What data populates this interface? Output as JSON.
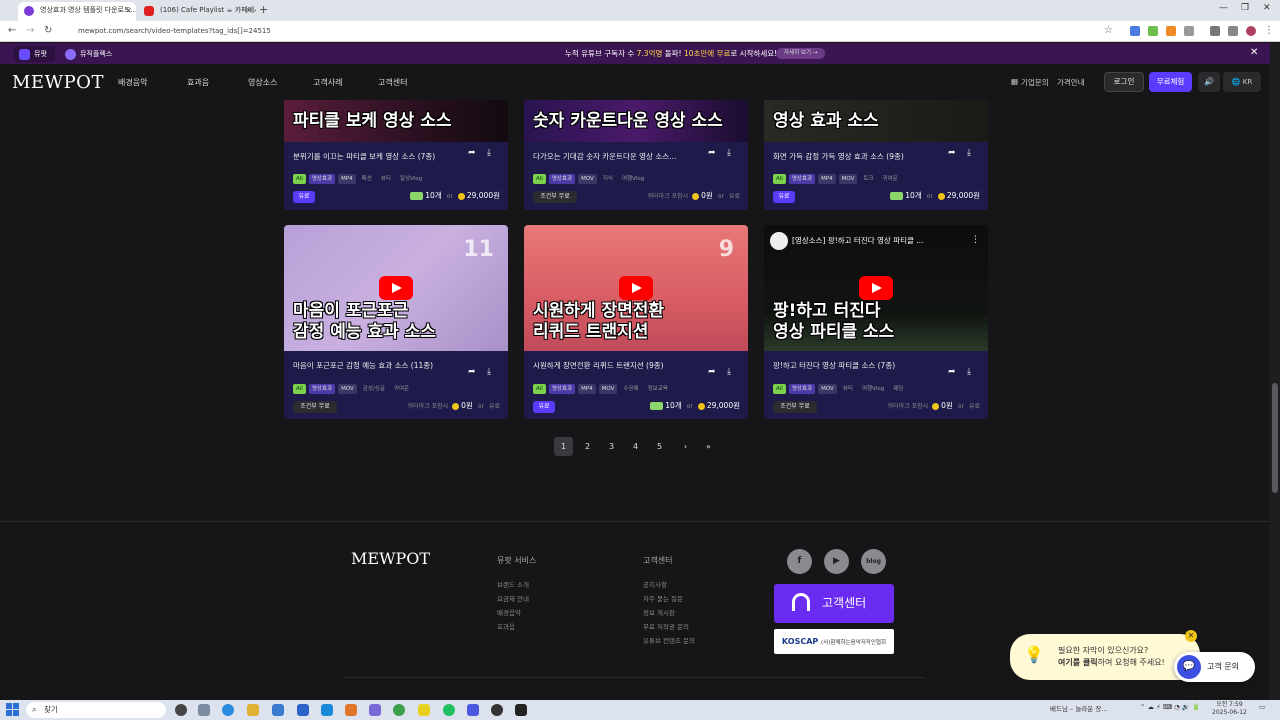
{
  "browser": {
    "tabs": [
      {
        "title": "영상효과 영상 템플릿 다운로드...",
        "active": true
      },
      {
        "title": "(106) Cafe Playlist ☕ 카페에서...",
        "active": false
      }
    ],
    "url": "mewpot.com/search/video-templates?tag_ids[]=24515"
  },
  "promo": {
    "bookmark1": "뮤팟",
    "bookmark2": "뮤직플렉스",
    "text_a": "누적 유튜브 구독자 수 ",
    "text_b": "7.3억명",
    "text_c": " 돌파! ",
    "text_d": "10초만에 무료",
    "text_e": "로 시작하세요!",
    "pill": "자세히 보기 →",
    "close": "✕"
  },
  "nav": {
    "brand": "MEWPOT",
    "menu": [
      "배경음악",
      "효과음",
      "영상소스",
      "고객사례",
      "고객센터"
    ],
    "enterprise": "기업문의",
    "pricing": "가격안내",
    "login": "로그인",
    "trial": "무료체험",
    "sound": "🔊",
    "lang": "🌐 KR"
  },
  "top_cards": [
    {
      "thumb_title": "파티클 보케 영상 소스",
      "title": "분위기를 이끄는 파티클 보케 영상 소스 (7종)",
      "tags": [
        "All",
        "영상효과",
        "MP4",
        "패션",
        "뷰티",
        "일상Vlog"
      ],
      "price_type": "paid",
      "badge": "유료",
      "tickets": "10개",
      "or": "or",
      "price": "29,000원"
    },
    {
      "thumb_title": "숫자 카운트다운 영상 소스",
      "title": "다가오는 기대감 숫자 카운트다운 영상 소스...",
      "tags": [
        "All",
        "영상효과",
        "MOV",
        "지식",
        "여행Vlog"
      ],
      "price_type": "free",
      "badge": "조건부 무료",
      "note": "워터마크 포함시",
      "price": "0원",
      "or": "or",
      "alt": "유료"
    },
    {
      "thumb_title": "영상 효과 소스",
      "title": "화면 가득 감정 가득 영상 효과 소스 (9종)",
      "tags": [
        "All",
        "영상효과",
        "MP4",
        "MOV",
        "토크",
        "귀여운"
      ],
      "price_type": "paid",
      "badge": "유료",
      "tickets": "10개",
      "or": "or",
      "price": "29,000원"
    }
  ],
  "bottom_cards": [
    {
      "thumb_line1": "마음이 포근포근",
      "thumb_line2": "감정 예능 효과 소스",
      "count": "11",
      "title": "마음이 포근포근 감정 예능 효과 소스 (11종)",
      "tags": [
        "All",
        "영상효과",
        "MOV",
        "감성/싱글",
        "귀여운"
      ],
      "price_type": "free",
      "badge": "조건부 무료",
      "note": "워터마크 포함시",
      "price": "0원",
      "or": "or",
      "alt": "유료"
    },
    {
      "thumb_line1": "시원하게 장면전환",
      "thumb_line2": "리퀴드 트랜지션",
      "count": "9",
      "title": "시원하게 장면전환 리퀴드 트랜지션 (9종)",
      "tags": [
        "All",
        "영상효과",
        "MP4",
        "MOV",
        "수공예",
        "정보교육"
      ],
      "price_type": "paid",
      "badge": "유료",
      "tickets": "10개",
      "or": "or",
      "price": "29,000원"
    },
    {
      "yt_title": "[영상소스] 팡!하고 터진다 영상 파티클 ...",
      "thumb_line1": "팡!하고 터진다",
      "thumb_line2": "영상 파티클 소스",
      "title": "팡!하고 터진다 영상 파티클 소스 (7종)",
      "tags": [
        "All",
        "영상효과",
        "MOV",
        "뷰티",
        "여행Vlog",
        "웨딩"
      ],
      "price_type": "free",
      "badge": "조건부 무료",
      "note": "워터마크 포함시",
      "price": "0원",
      "or": "or",
      "alt": "유료"
    }
  ],
  "pagination": [
    "1",
    "2",
    "3",
    "4",
    "5",
    "›",
    "»"
  ],
  "footer": {
    "brand": "MEWPOT",
    "service_head": "뮤팟 서비스",
    "service_links": [
      "브랜드 소개",
      "요금제 안내",
      "배경음악",
      "효과음"
    ],
    "support_head": "고객센터",
    "support_links": [
      "공지사항",
      "자주 묻는 질문",
      "정보 게시판",
      "무료 저작권 문의",
      "유튜브 컨텐츠 문의"
    ],
    "social": [
      "f",
      "▶",
      "blog"
    ],
    "cs_button": "고객센터",
    "koscap": "KOSCAP",
    "koscap_sub": "(사)함께하는음악저작인협회"
  },
  "chat": {
    "line1": "필요한 자막이 있으신가요?",
    "line2_bold": "여기를 클릭",
    "line2_rest": "하여 요청해 주세요!",
    "button": "고객 문의",
    "close": "✕"
  },
  "taskbar": {
    "search": "찾기",
    "tray_text": "베드님 – 놀라운 장...",
    "time": "오전 7:59",
    "date": "2025-06-12"
  }
}
